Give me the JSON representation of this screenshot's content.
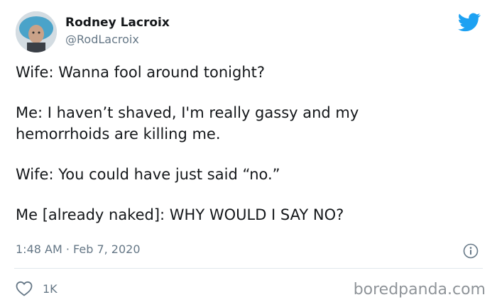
{
  "author": {
    "display_name": "Rodney Lacroix",
    "handle": "@RodLacroix"
  },
  "tweet": {
    "lines": [
      "Wife: Wanna fool around tonight?",
      "Me: I haven’t shaved, I'm really gassy and my",
      "hemorrhoids are killing me.",
      "Wife: You could have just said “no.”",
      "Me [already naked]: WHY WOULD I SAY NO?"
    ],
    "timestamp": "1:48 AM · Feb 7, 2020"
  },
  "actions": {
    "like_count": "1K"
  },
  "watermark": "boredpanda.com",
  "icons": {
    "brand": "twitter-bird-icon",
    "info": "info-icon",
    "like": "heart-icon"
  },
  "colors": {
    "twitter_blue": "#1da1f2",
    "secondary_text": "#657786",
    "divider": "#e1e8ed"
  }
}
